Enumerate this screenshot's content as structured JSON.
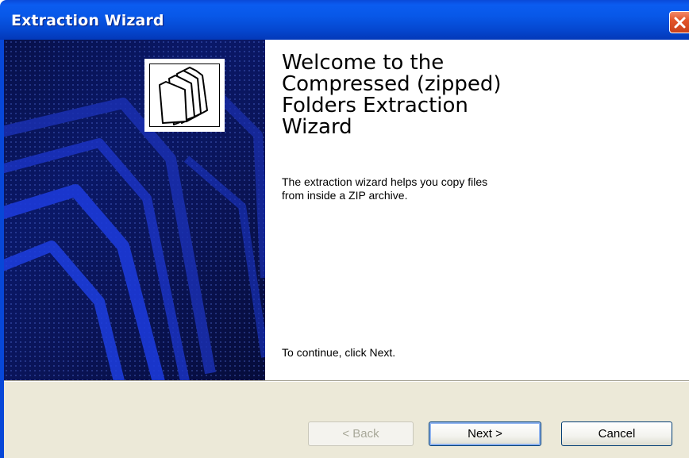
{
  "window": {
    "title": "Extraction Wizard",
    "close_icon": "close-icon"
  },
  "banner": {
    "icon": "folders-icon"
  },
  "content": {
    "heading": "Welcome to the\nCompressed (zipped)\nFolders Extraction\nWizard",
    "description": "The extraction wizard helps you copy files\nfrom inside a ZIP archive.",
    "continue_text": "To continue, click Next."
  },
  "buttons": {
    "back": "< Back",
    "next": "Next >",
    "cancel": "Cancel"
  },
  "colors": {
    "titlebar": "#0858e8",
    "banner": "#0a1868",
    "footer": "#ece9d8",
    "close": "#e2552a"
  }
}
